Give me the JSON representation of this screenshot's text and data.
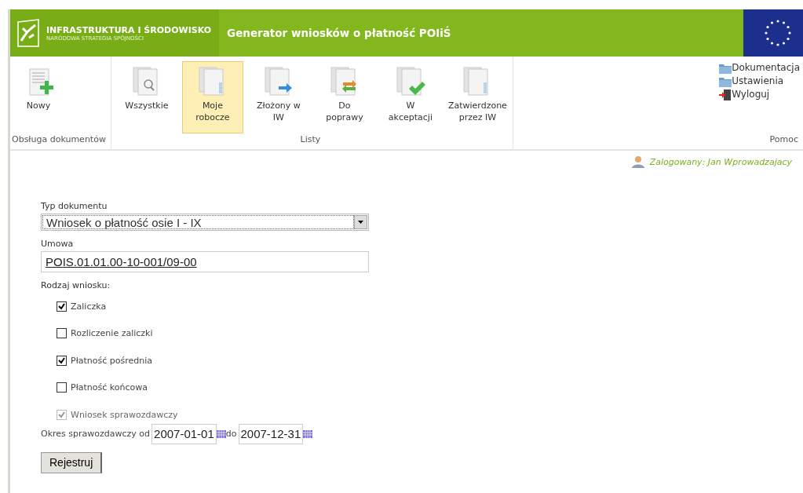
{
  "header": {
    "brand": "INFRASTRUKTURA I ŚRODOWISKO",
    "brand_subtitle": "NARODOWA STRATEGIA SPÓJNOŚCI",
    "title": "Generator wniosków o płatność POIiŚ"
  },
  "toolbar": {
    "groups": [
      {
        "label": "Obsługa dokumentów",
        "kind": "buttons",
        "items": [
          {
            "label": "Nowy",
            "kind": "new",
            "selected": false
          }
        ]
      },
      {
        "label": "Listy",
        "kind": "buttons",
        "items": [
          {
            "label": "Wszystkie",
            "kind": "search",
            "selected": false
          },
          {
            "label": "Moje robocze",
            "kind": "plain",
            "selected": true
          },
          {
            "label": "Złożony w IW",
            "kind": "arrow",
            "selected": false
          },
          {
            "label": "Do poprawy",
            "kind": "swap",
            "selected": false
          },
          {
            "label": "W akceptacji",
            "kind": "check",
            "selected": false
          },
          {
            "label": "Zatwierdzone przez IW",
            "kind": "plain",
            "selected": false
          }
        ]
      },
      {
        "label": "Pomoc",
        "kind": "links",
        "items": [
          {
            "label": "Dokumentacja",
            "kind": "folder"
          },
          {
            "label": "Ustawienia",
            "kind": "folder"
          },
          {
            "label": "Wyloguj",
            "kind": "logout"
          }
        ]
      }
    ]
  },
  "user": "Zalogowany: Jan Wprowadzajacy",
  "form": {
    "document_type_label": "Typ dokumentu",
    "document_type": "Wniosek o płatność osie I - IX",
    "contract_label": "Umowa",
    "contract": "POIS.01.01.00-10-001/09-00",
    "kind_label": "Rodzaj wniosku:",
    "kinds": [
      {
        "label": "Zaliczka",
        "checked": true,
        "disabled": false
      },
      {
        "label": "Rozliczenie zaliczki",
        "checked": false,
        "disabled": false
      },
      {
        "label": "Płatność pośrednia",
        "checked": true,
        "disabled": false
      },
      {
        "label": "Płatność końcowa",
        "checked": false,
        "disabled": false
      },
      {
        "label": "Wniosek sprawozdawczy",
        "checked": true,
        "disabled": true
      }
    ],
    "period_label": "Okres sprawozdawczy od",
    "period_from": "2007-01-01",
    "period_to_label": "do",
    "period_to": "2007-12-31",
    "submit": "Rejestruj"
  }
}
